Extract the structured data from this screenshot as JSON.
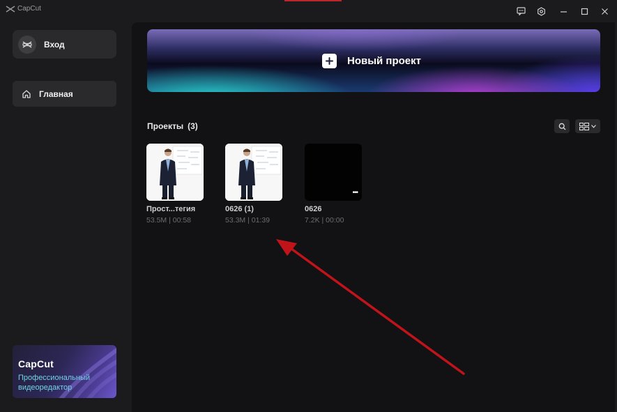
{
  "window": {
    "app_name": "CapCut",
    "controls": [
      "feedback-icon",
      "settings-icon",
      "minimize-icon",
      "maximize-icon",
      "close-icon"
    ]
  },
  "sidebar": {
    "login_label": "Вход",
    "home_label": "Главная",
    "promo": {
      "title": "CapCut",
      "subtitle": "Профессиональный видеоредактор"
    }
  },
  "main": {
    "new_project_label": "Новый проект",
    "projects_heading": "Проекты",
    "projects_count": "(3)",
    "projects": [
      {
        "name": "Прост...тегия",
        "meta": "53.5M | 00:58",
        "thumb": "presenter"
      },
      {
        "name": "0626 (1)",
        "meta": "53.3M | 01:39",
        "thumb": "presenter"
      },
      {
        "name": "0626",
        "meta": "7.2K | 00:00",
        "thumb": "black"
      }
    ]
  },
  "colors": {
    "background": "#1b1b1d",
    "main_panel": "#121214",
    "annotation_arrow": "#c0141a",
    "promo_accent": "#6fd4e6"
  }
}
